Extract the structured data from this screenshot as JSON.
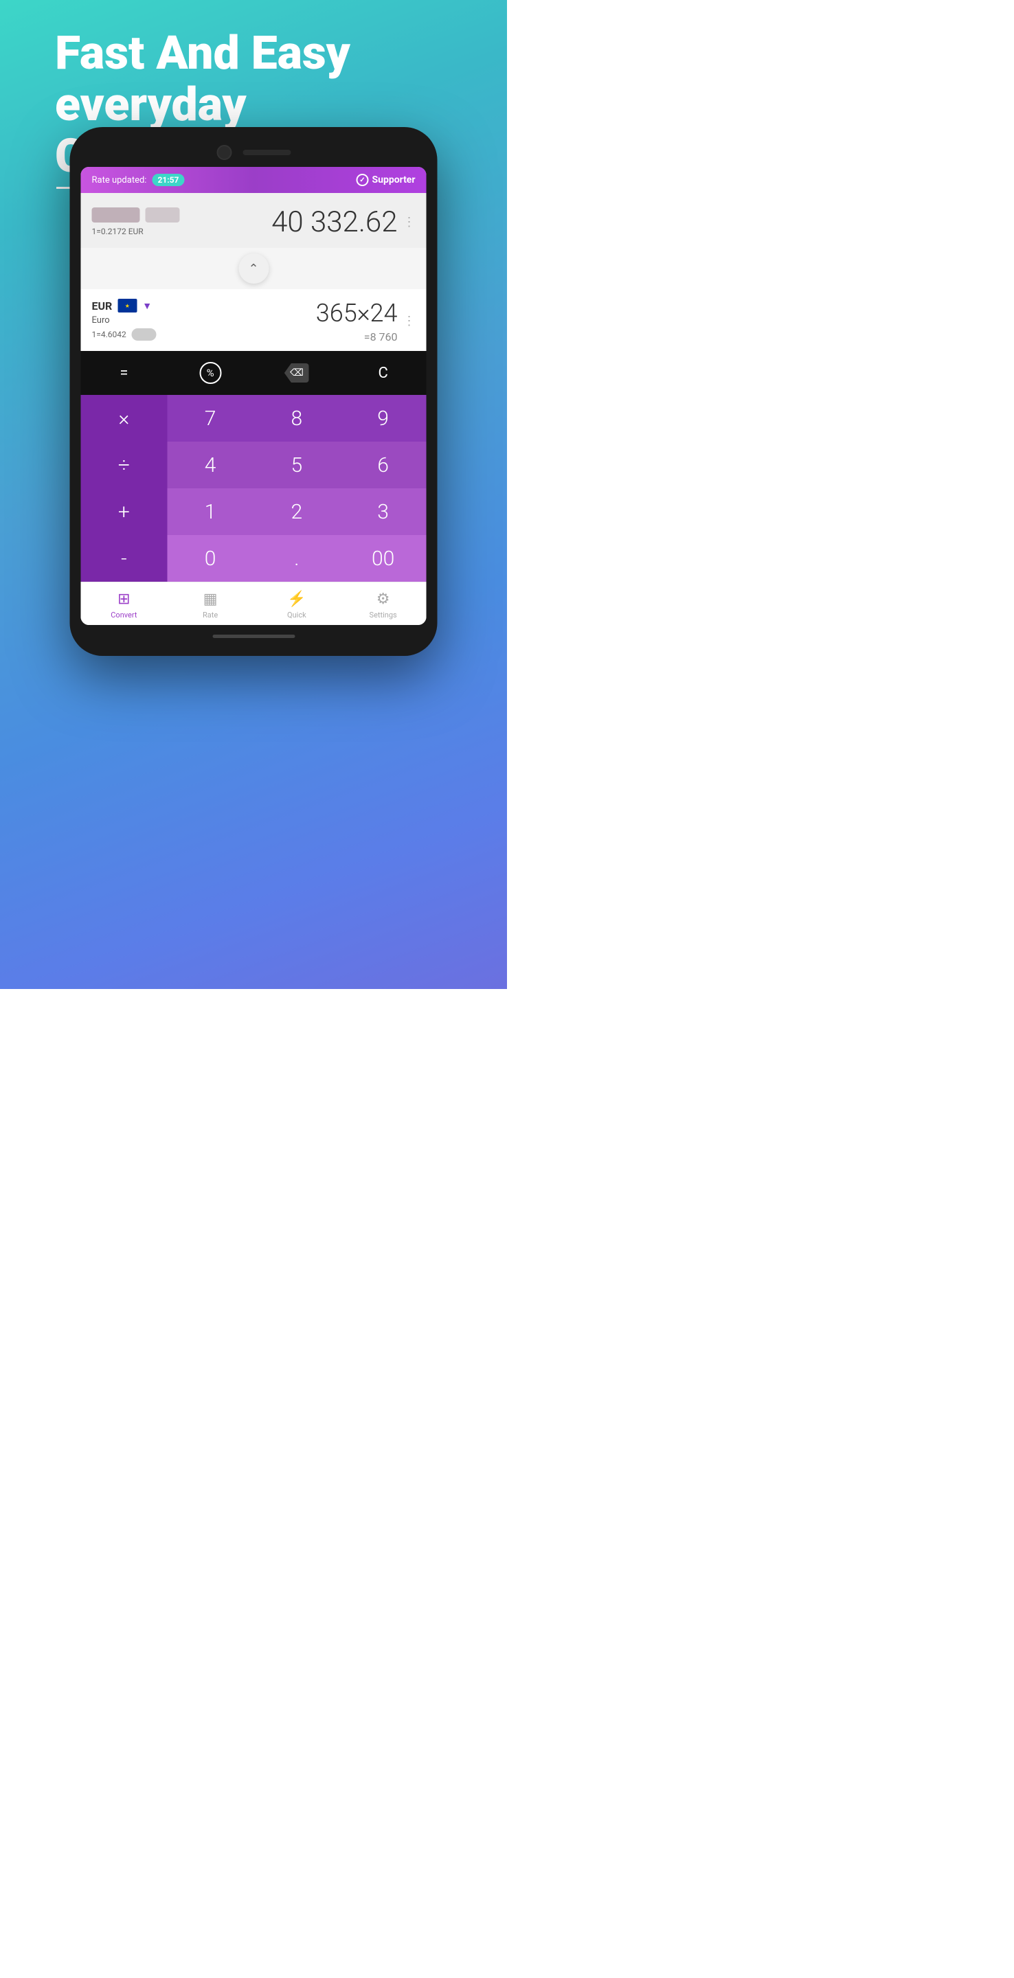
{
  "background": {
    "gradient_start": "#3dd6c8",
    "gradient_end": "#6b70e0"
  },
  "hero": {
    "line1": "Fast And Easy",
    "line2": "everyday",
    "line3": "Converter"
  },
  "status_bar": {
    "rate_label": "Rate updated:",
    "time": "21:57",
    "supporter": "Supporter"
  },
  "converter": {
    "row1": {
      "amount": "40 332.62",
      "rate_text": "1=0.2172 EUR"
    },
    "row2": {
      "currency_code": "EUR",
      "currency_name": "Euro",
      "rate_text": "1=4.6042",
      "expression": "365×24",
      "result": "=8 760"
    }
  },
  "keypad": {
    "special": {
      "equals": "=",
      "percent": "%",
      "backspace": "⌫",
      "clear": "C"
    },
    "rows": [
      [
        "×",
        "7",
        "8",
        "9"
      ],
      [
        "÷",
        "4",
        "5",
        "6"
      ],
      [
        "+",
        "1",
        "2",
        "3"
      ],
      [
        "-",
        "0",
        ".",
        "00"
      ]
    ]
  },
  "nav": {
    "items": [
      {
        "label": "Convert",
        "icon": "⊞",
        "active": true
      },
      {
        "label": "Rate",
        "icon": "▦",
        "active": false
      },
      {
        "label": "Quick",
        "icon": "⚡",
        "active": false
      },
      {
        "label": "Settings",
        "icon": "⚙",
        "active": false
      }
    ]
  }
}
